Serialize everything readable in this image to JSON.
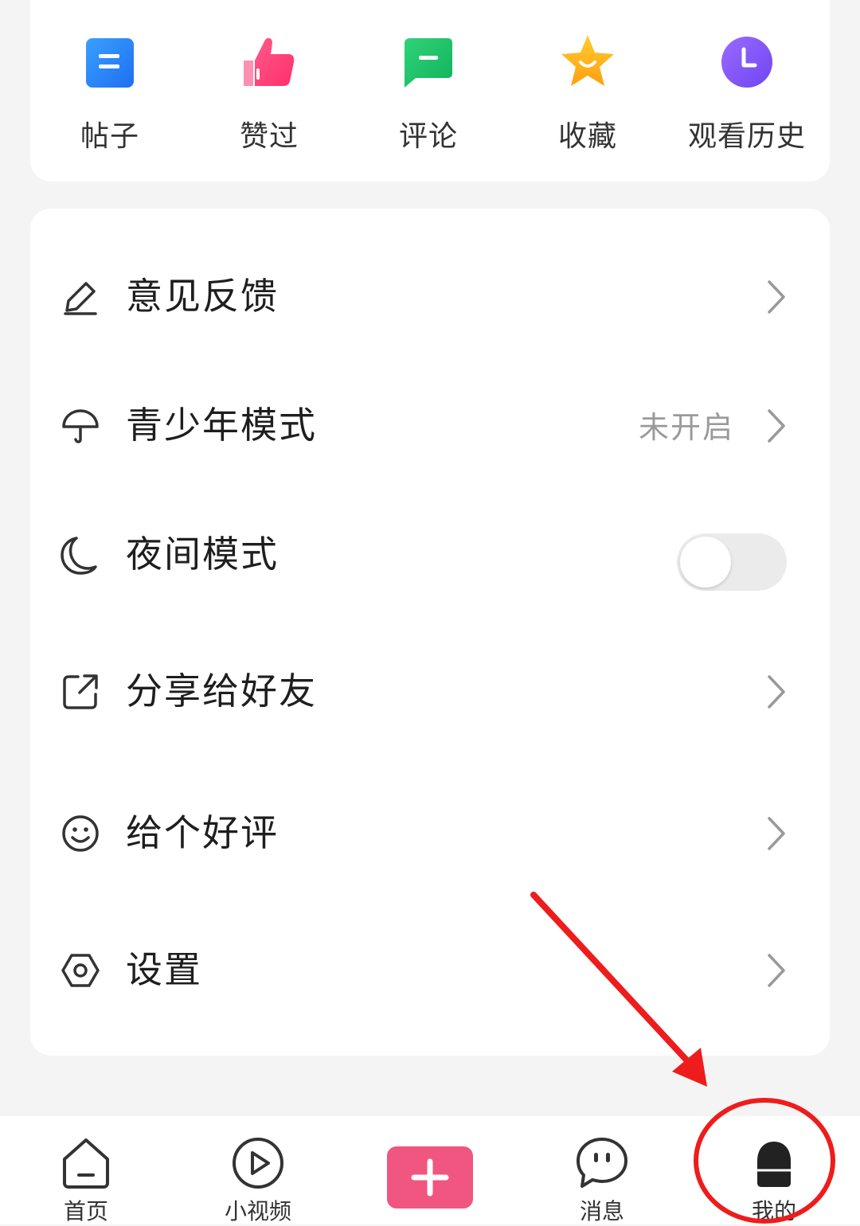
{
  "quick_actions": [
    {
      "label": "帖子",
      "icon": "post-icon",
      "color": "#2f8cf5"
    },
    {
      "label": "赞过",
      "icon": "thumbs-up-icon",
      "color": "#ff3d7a"
    },
    {
      "label": "评论",
      "icon": "comment-icon",
      "color": "#1fc46a"
    },
    {
      "label": "收藏",
      "icon": "star-icon",
      "color": "#ffb21e"
    },
    {
      "label": "观看历史",
      "icon": "clock-icon",
      "color": "#8a5cf5"
    }
  ],
  "menu": {
    "feedback": {
      "label": "意见反馈",
      "icon": "pencil-icon"
    },
    "youth_mode": {
      "label": "青少年模式",
      "status": "未开启",
      "icon": "umbrella-icon"
    },
    "night_mode": {
      "label": "夜间模式",
      "icon": "moon-icon",
      "enabled": false
    },
    "share": {
      "label": "分享给好友",
      "icon": "share-icon"
    },
    "rate": {
      "label": "给个好评",
      "icon": "smiley-icon"
    },
    "settings": {
      "label": "设置",
      "icon": "gear-icon"
    }
  },
  "tabbar": {
    "home": "首页",
    "video": "小视频",
    "messages": "消息",
    "me": "我的",
    "accent_color": "#f0567f"
  }
}
